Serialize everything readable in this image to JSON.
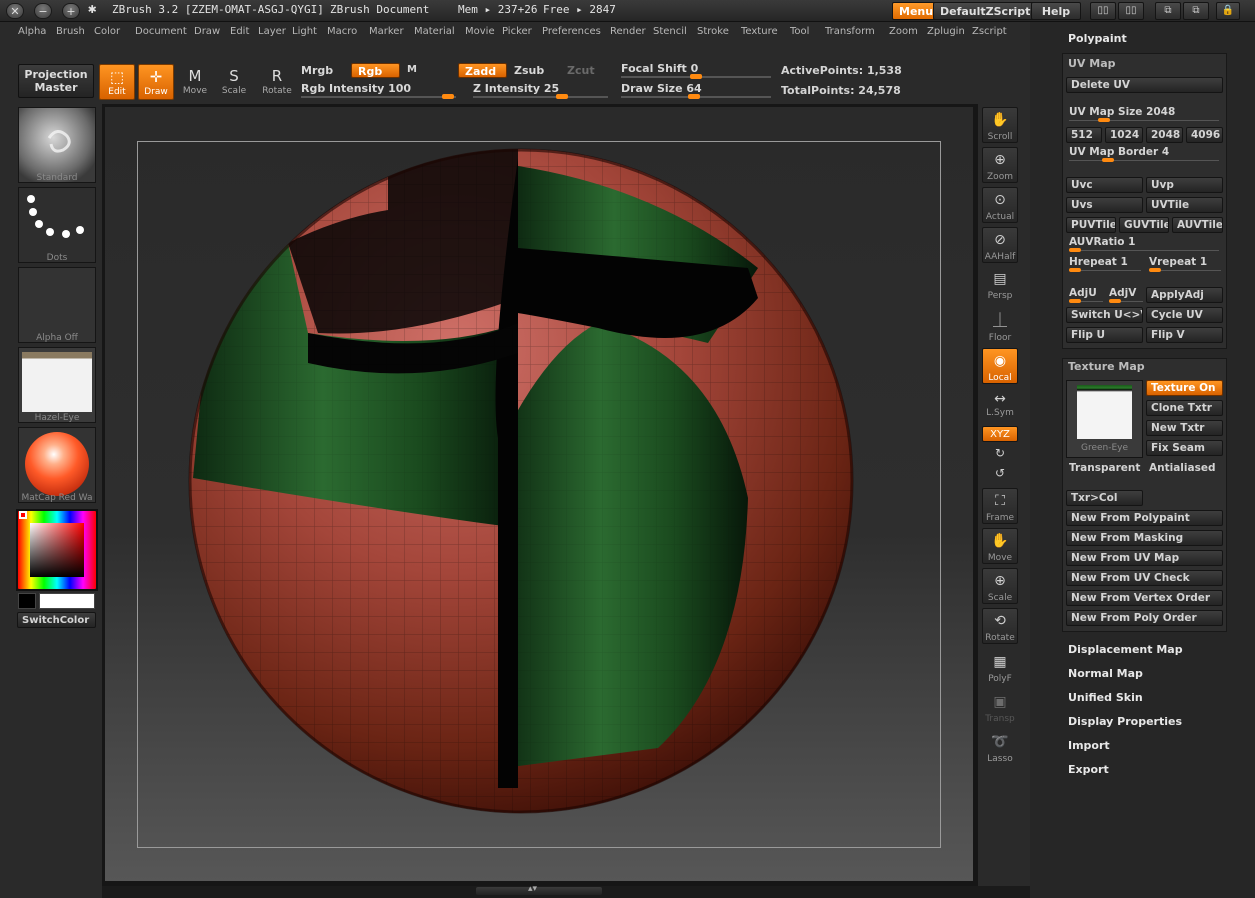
{
  "titlebar": {
    "app": "ZBrush 3.2 [ZZEM-OMAT-ASGJ-QYGI]",
    "document": "ZBrush Document",
    "mem": "Mem ▸ 237+26",
    "free": "Free ▸ 2847",
    "menus": "Menus",
    "script": "DefaultZScript",
    "help": "Help"
  },
  "menu": [
    "Alpha",
    "Brush",
    "Color",
    "Document",
    "Draw",
    "Edit",
    "Layer",
    "Light",
    "Macro",
    "Marker",
    "Material",
    "Movie",
    "Picker",
    "Preferences",
    "Render",
    "Stencil",
    "Stroke",
    "Texture",
    "Tool",
    "Transform",
    "Zoom",
    "Zplugin",
    "Zscript"
  ],
  "shelf": {
    "projection_master": "Projection Master",
    "edit": "Edit",
    "draw": "Draw",
    "move": "Move",
    "scale": "Scale",
    "rotate": "Rotate",
    "mrgb": "Mrgb",
    "rgb": "Rgb",
    "m": "M",
    "zadd": "Zadd",
    "zsub": "Zsub",
    "zcut": "Zcut",
    "rgb_intensity": "Rgb Intensity 100",
    "z_intensity": "Z Intensity 25",
    "focal_shift": "Focal Shift 0",
    "draw_size": "Draw Size 64",
    "active_points": "ActivePoints: 1,538",
    "total_points": "TotalPoints: 24,578"
  },
  "left": {
    "brush": "Standard",
    "stroke": "Dots",
    "alpha": "Alpha Off",
    "texture": "Hazel-Eye",
    "material": "MatCap Red Wa",
    "switch_color": "SwitchColor"
  },
  "strip": {
    "scroll": "Scroll",
    "zoom": "Zoom",
    "actual": "Actual",
    "aahalf": "AAHalf",
    "persp": "Persp",
    "floor": "Floor",
    "local": "Local",
    "lsym": "L.Sym",
    "xyz": "XYZ",
    "frame": "Frame",
    "move": "Move",
    "scale": "Scale",
    "rotate": "Rotate",
    "polyf": "PolyF",
    "transp": "Transp",
    "lasso": "Lasso"
  },
  "panel": {
    "polypaint": "Polypaint",
    "uvmap": {
      "title": "UV Map",
      "delete_uv": "Delete UV",
      "size": "UV Map Size 2048",
      "sizes": [
        "512",
        "1024",
        "2048",
        "4096"
      ],
      "border": "UV Map Border 4",
      "uvc": "Uvc",
      "uvp": "Uvp",
      "uvs": "Uvs",
      "uvtile": "UVTile",
      "puvtiles": "PUVTiles",
      "guvtiles": "GUVTiles",
      "auvtiles": "AUVTiles",
      "auvratio": "AUVRatio 1",
      "hrepeat": "Hrepeat 1",
      "vrepeat": "Vrepeat 1",
      "adju": "AdjU",
      "adjv": "AdjV",
      "applyadj": "ApplyAdj",
      "switch_uv": "Switch U<>V",
      "cycle_uv": "Cycle UV",
      "flip_u": "Flip U",
      "flip_v": "Flip V"
    },
    "texmap": {
      "title": "Texture Map",
      "texture_on": "Texture On",
      "clone_txtr": "Clone Txtr",
      "new_txtr": "New Txtr",
      "fix_seam": "Fix Seam",
      "thumb_label": "Green-Eye",
      "transparent": "Transparent",
      "antialiased": "Antialiased",
      "txr_col": "Txr>Col",
      "new_from": [
        "New From Polypaint",
        "New From Masking",
        "New From UV Map",
        "New From UV Check",
        "New From Vertex Order",
        "New From Poly Order"
      ]
    },
    "sections": [
      "Displacement Map",
      "Normal Map",
      "Unified Skin",
      "Display Properties",
      "Import",
      "Export"
    ]
  },
  "colors": {
    "accent": "#ff8a10",
    "panel": "#2a2a2a",
    "sphere_red": "#a8463a",
    "sphere_green": "#1f5a26"
  }
}
